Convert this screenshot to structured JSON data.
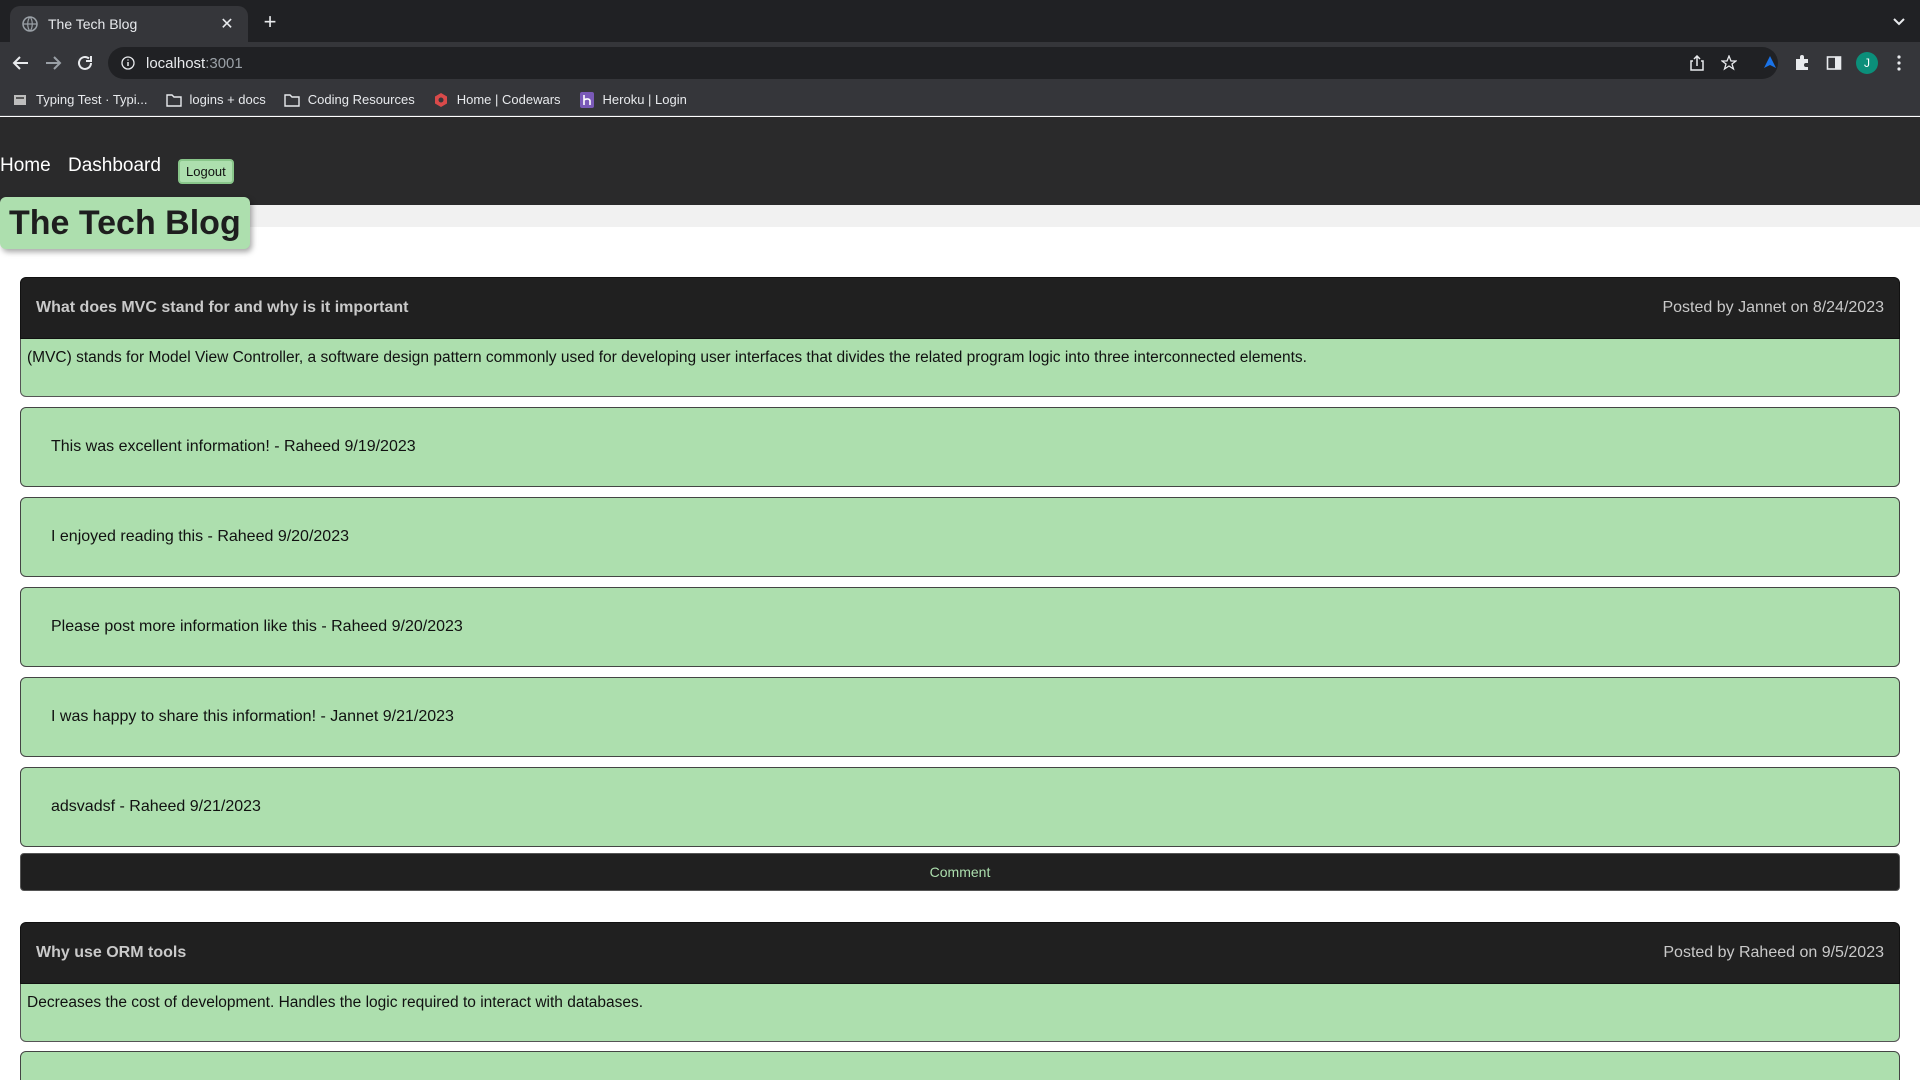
{
  "browser": {
    "tab_title": "The Tech Blog",
    "url_host": "localhost",
    "url_port": ":3001",
    "profile_initial": "J",
    "bookmarks": [
      {
        "label": "Typing Test · Typi..."
      },
      {
        "label": "logins + docs"
      },
      {
        "label": "Coding Resources"
      },
      {
        "label": "Home | Codewars"
      },
      {
        "label": "Heroku | Login"
      }
    ]
  },
  "site": {
    "nav": {
      "home": "Home",
      "dashboard": "Dashboard",
      "logout": "Logout"
    },
    "brand": "The Tech Blog",
    "comment_button": "Comment",
    "posts": [
      {
        "title": "What does MVC stand for and why is it important",
        "meta": "Posted by Jannet on 8/24/2023",
        "body": "(MVC) stands for Model View Controller, a software design pattern commonly used for developing user interfaces that divides the related program logic into three interconnected elements.",
        "comments": [
          "This was excellent information! - Raheed 9/19/2023",
          "I enjoyed reading this - Raheed 9/20/2023",
          "Please post more information like this - Raheed 9/20/2023",
          "I was happy to share this information! - Jannet 9/21/2023",
          "adsvadsf - Raheed 9/21/2023"
        ]
      },
      {
        "title": "Why use ORM tools",
        "meta": "Posted by Raheed on 9/5/2023",
        "body": "Decreases the cost of development. Handles the logic required to interact with databases.",
        "comments": []
      }
    ]
  }
}
